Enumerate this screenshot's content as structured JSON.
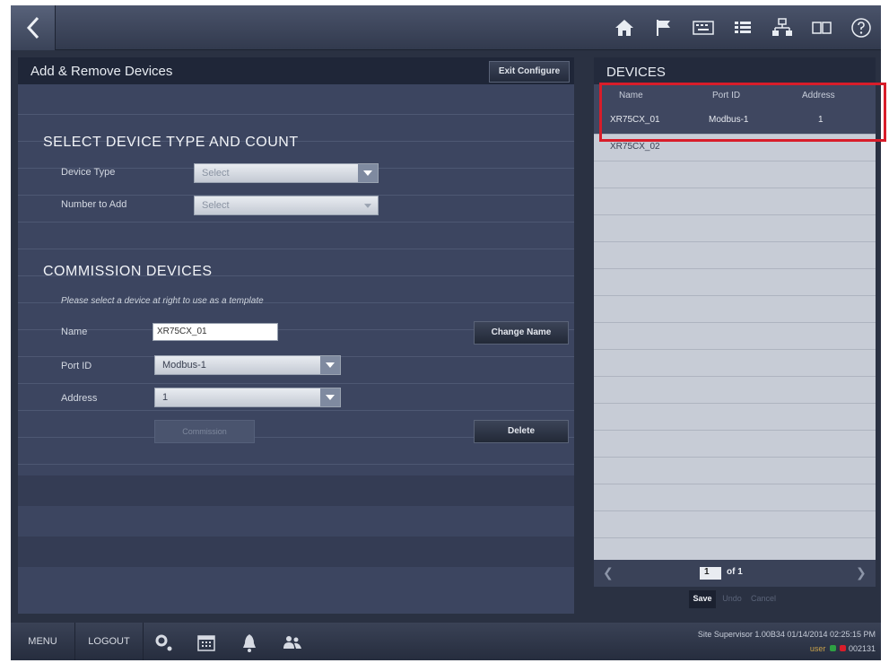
{
  "left_panel": {
    "title": "Add & Remove Devices",
    "exit_label": "Exit Configure",
    "section1_title": "SELECT DEVICE TYPE AND COUNT",
    "device_type_label": "Device Type",
    "device_type_value": "Select",
    "number_label": "Number to Add",
    "number_value": "Select",
    "section2_title": "COMMISSION DEVICES",
    "hint": "Please select a device at right to use as a template",
    "name_label": "Name",
    "name_value": "XR75CX_01",
    "change_name_label": "Change Name",
    "port_label": "Port ID",
    "port_value": "Modbus-1",
    "address_label": "Address",
    "address_value": "1",
    "commission_label": "Commission",
    "delete_label": "Delete"
  },
  "devices": {
    "title": "DEVICES",
    "columns": [
      "Name",
      "Port ID",
      "Address"
    ],
    "rows": [
      {
        "name": "XR75CX_01",
        "port": "Modbus-1",
        "address": "1"
      },
      {
        "name": "XR75CX_02",
        "port": "",
        "address": ""
      }
    ],
    "page": "1",
    "page_of": "of 1",
    "save_label": "Save",
    "undo_label": "Undo",
    "cancel_label": "Cancel"
  },
  "bottom": {
    "menu_label": "MENU",
    "logout_label": "LOGOUT",
    "status_line": "Site Supervisor 1.00B34 01/14/2014 02:25:15 PM",
    "user_label": "user",
    "session_code": "002131"
  },
  "colors": {
    "highlight": "#d81d2a",
    "panel_bg": "#3c4560",
    "device_list_bg": "#c7ccd6"
  },
  "icons": [
    "back-icon",
    "home-icon",
    "flag-icon",
    "keyboard-icon",
    "list-icon",
    "network-icon",
    "book-icon",
    "help-icon",
    "settings-icon",
    "calendar-icon",
    "alarm-bell-icon",
    "users-icon"
  ]
}
